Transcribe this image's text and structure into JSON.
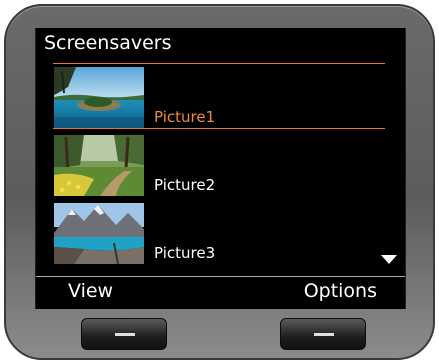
{
  "screen": {
    "title": "Screensavers"
  },
  "list": {
    "items": [
      {
        "label": "Picture1",
        "selected": true,
        "thumbnail": "island-lake-photo"
      },
      {
        "label": "Picture2",
        "selected": false,
        "thumbnail": "forest-path-photo"
      },
      {
        "label": "Picture3",
        "selected": false,
        "thumbnail": "mountain-lake-photo"
      }
    ]
  },
  "softkeys": {
    "left": "View",
    "right": "Options"
  },
  "colors": {
    "highlight": "#e8752a",
    "screen_bg": "#000000",
    "device_body": "#5c5c5c"
  },
  "icons": {
    "scroll_down": "triangle-down-icon"
  }
}
